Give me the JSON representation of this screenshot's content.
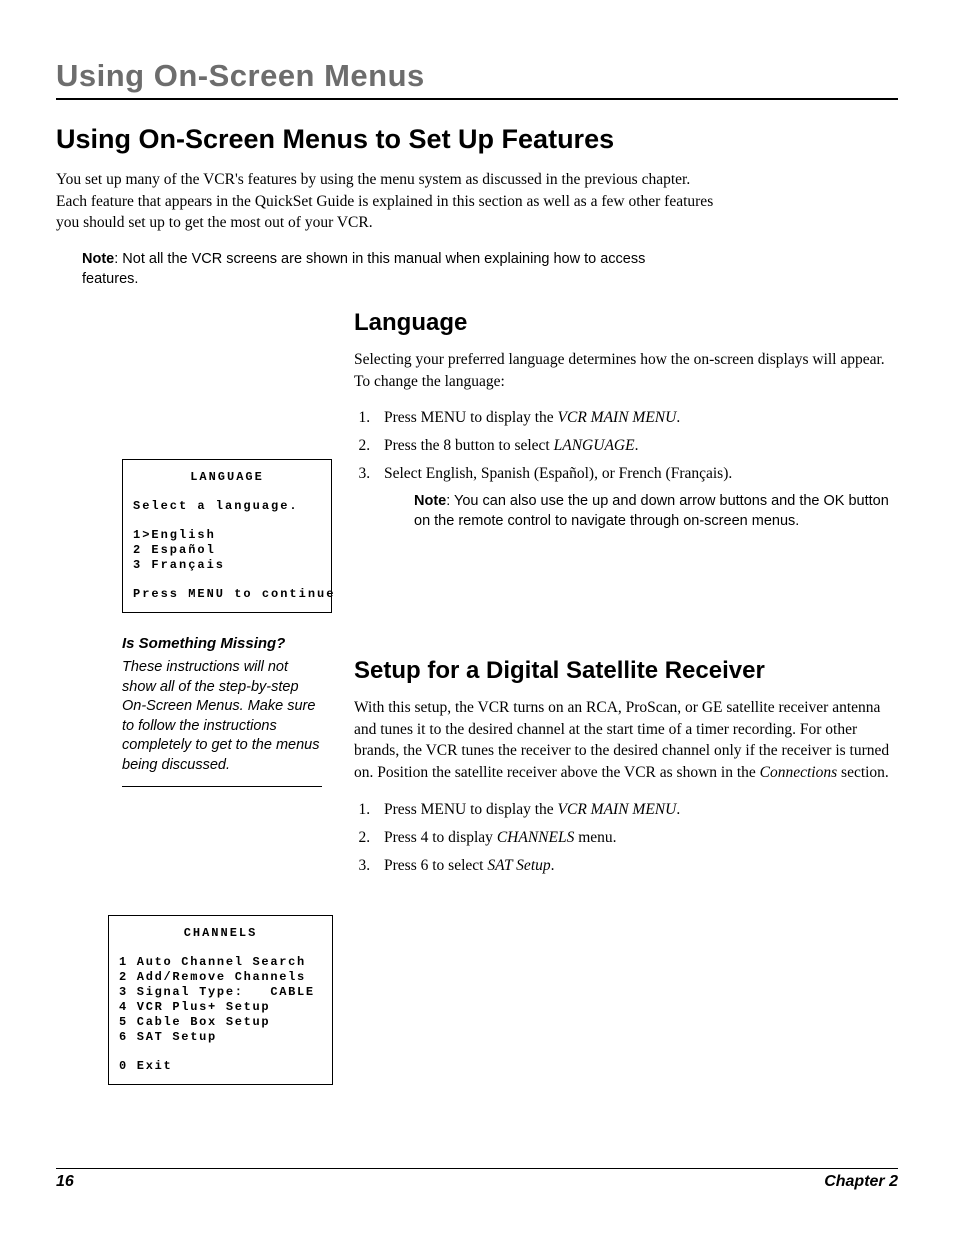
{
  "header": {
    "running_title": "Using On-Screen Menus"
  },
  "main": {
    "title": "Using On-Screen Menus to Set Up Features",
    "intro": "You set up many of the VCR's features by using the menu system as discussed in the previous chapter. Each feature that appears in the QuickSet Guide is explained in this section as well as a few other features you should set up to get the most out of your VCR.",
    "note_label": "Note",
    "note_text": ": Not all the VCR screens are shown in this manual when explaining how to access features."
  },
  "language": {
    "title": "Language",
    "intro": "Selecting your preferred language determines how the on-screen displays will appear. To change the language:",
    "step1_a": "Press MENU to display the ",
    "step1_b": "VCR MAIN MENU",
    "step1_c": ".",
    "step2_a": "Press the 8 button to select ",
    "step2_b": "LANGUAGE",
    "step2_c": ".",
    "step3": "Select English, Spanish (Español), or French (Français).",
    "note_label": "Note",
    "note_text": ": You can also use the up and down arrow buttons and the OK button on the remote control to navigate through on-screen menus."
  },
  "osd_language": {
    "title": "LANGUAGE",
    "prompt": "Select a language.",
    "opt1": "1>English",
    "opt2": "2 Español",
    "opt3": "3 Français",
    "footer": "Press MENU to continue"
  },
  "sidebar": {
    "heading": "Is Something Missing?",
    "para": "These instructions will not show all of the step-by-step On-Screen Menus. Make sure to follow the instructions completely to get to the menus being discussed."
  },
  "satellite": {
    "title": "Setup for a Digital Satellite Receiver",
    "intro_a": "With this setup, the VCR turns on an RCA, ProScan, or GE satellite receiver antenna and tunes it to the desired channel at the start time of a timer recording. For other brands, the VCR tunes the receiver to the desired channel only if the receiver is turned on. Position the satellite receiver above the VCR as shown in the ",
    "intro_b": "Connections",
    "intro_c": " section.",
    "step1_a": "Press MENU to display the ",
    "step1_b": "VCR MAIN MENU",
    "step1_c": ".",
    "step2_a": "Press 4 to display ",
    "step2_b": "CHANNELS",
    "step2_c": " menu.",
    "step3_a": "Press 6 to select ",
    "step3_b": "SAT Setup",
    "step3_c": "."
  },
  "osd_channels": {
    "title": "CHANNELS",
    "l1": "1 Auto Channel Search",
    "l2": "2 Add/Remove Channels",
    "l3": "3 Signal Type:   CABLE",
    "l4": "4 VCR Plus+ Setup",
    "l5": "5 Cable Box Setup",
    "l6": "6 SAT Setup",
    "exit": "0 Exit"
  },
  "footer": {
    "page": "16",
    "chapter": "Chapter 2"
  }
}
